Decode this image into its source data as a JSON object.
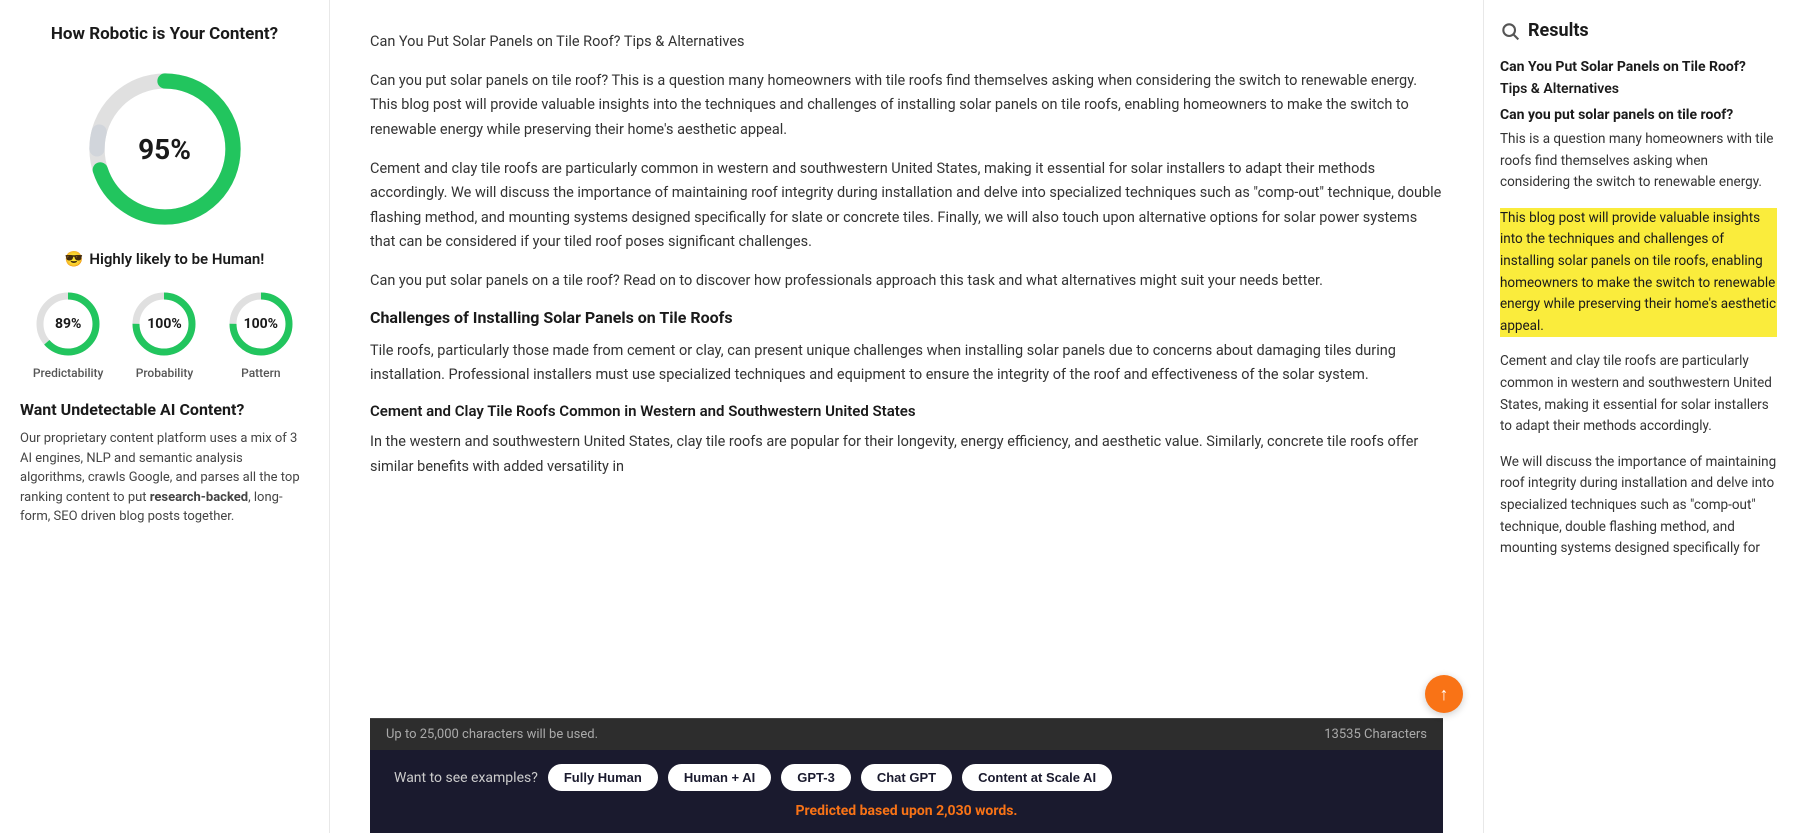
{
  "left": {
    "title": "How Robotic is Your Content?",
    "main_percent": "95%",
    "human_label": "Highly likely to be Human!",
    "emoji": "😎",
    "circles": [
      {
        "id": "predictability",
        "value": 89,
        "label": "Predictability",
        "text": "89%"
      },
      {
        "id": "probability",
        "value": 100,
        "label": "Probability",
        "text": "100%"
      },
      {
        "id": "pattern",
        "value": 100,
        "label": "Pattern",
        "text": "100%"
      }
    ],
    "cta_title": "Want Undetectable AI Content?",
    "cta_desc_1": "Our proprietary content platform uses a mix of 3 AI engines, NLP and semantic analysis algorithms, crawls Google, and parses all the top ranking content to put ",
    "cta_bold": "research-backed",
    "cta_desc_2": ", long-form, SEO driven blog posts together."
  },
  "middle": {
    "title": "Can You Put Solar Panels on Tile Roof? Tips & Alternatives",
    "paragraphs": [
      "Can you put solar panels on tile roof? This is a question many homeowners with tile roofs find themselves asking when considering the switch to renewable energy. This blog post will provide valuable insights into the techniques and challenges of installing solar panels on tile roofs, enabling homeowners to make the switch to renewable energy while preserving their home's aesthetic appeal.",
      "Cement and clay tile roofs are particularly common in western and southwestern United States, making it essential for solar installers to adapt their methods accordingly. We will discuss the importance of maintaining roof integrity during installation and delve into specialized techniques such as \"comp-out\" technique, double flashing method, and mounting systems designed specifically for slate or concrete tiles. Finally, we will also touch upon alternative options for solar power systems that can be considered if your tiled roof poses significant challenges.",
      "Can you put solar panels on a tile roof? Read on to discover how professionals approach this task and what alternatives might suit your needs better."
    ],
    "section1_title": "Challenges of Installing Solar Panels on Tile Roofs",
    "section1_para1": "Tile roofs, particularly those made from cement or clay, can present unique challenges when installing solar panels due to concerns about damaging tiles during installation. Professional installers must use specialized techniques and equipment to ensure the integrity of the roof and effectiveness of the solar system.",
    "section1_sub": "Cement and Clay Tile Roofs Common in Western and Southwestern United States",
    "section1_para2": "In the western and southwestern United States, clay tile roofs are popular for their longevity, energy efficiency, and aesthetic value. Similarly, concrete tile roofs offer similar benefits with added versatility in",
    "char_limit": "Up to 25,000 characters will be used.",
    "char_count": "13535 Characters"
  },
  "bottom": {
    "examples_label": "Want to see examples?",
    "pills": [
      "Fully Human",
      "Human + AI",
      "GPT-3",
      "Chat GPT",
      "Content at Scale AI"
    ],
    "predicted_text": "Predicted based upon ",
    "predicted_words": "2,030 words.",
    "word_count": "2,030"
  },
  "right": {
    "title": "Results",
    "heading1": "Can You Put Solar Panels on Tile Roof?",
    "heading2": "Tips & Alternatives",
    "heading3": "Can you put solar panels on tile roof?",
    "text1": "This is a question many homeowners with tile roofs find themselves asking when considering the switch to renewable energy.",
    "highlight": "This blog post will provide valuable insights into the techniques and challenges of installing solar panels on tile roofs, enabling homeowners to make the switch to renewable energy while preserving their home's aesthetic appeal.",
    "text2": "Cement and clay tile roofs are particularly common in western and southwestern United States, making it essential for solar installers to adapt their methods accordingly.",
    "text3": "We will discuss the importance of maintaining roof integrity during installation and delve into specialized techniques such as \"comp-out\" technique, double flashing method, and mounting systems designed specifically for"
  }
}
